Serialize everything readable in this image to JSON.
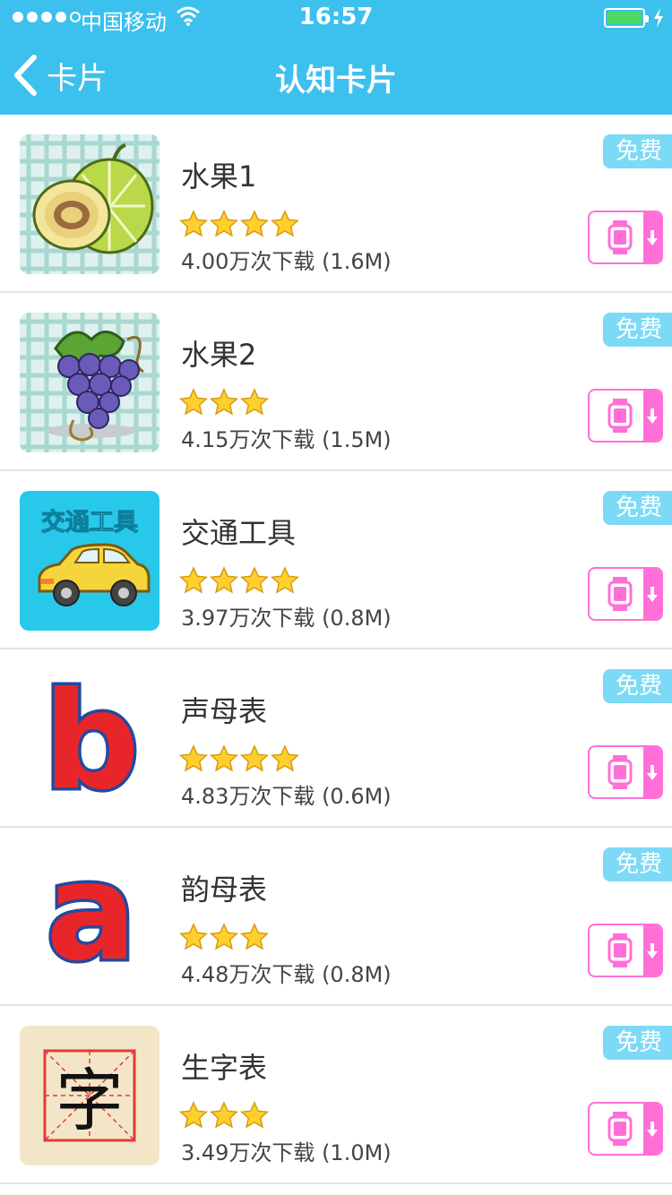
{
  "status_bar": {
    "carrier": "中国移动",
    "time": "16:57",
    "battery_color": "#4cd964"
  },
  "nav": {
    "back_label": "卡片",
    "title": "认知卡片"
  },
  "theme": {
    "header_color": "#3cc0ee",
    "badge_color": "#7ddaf6",
    "button_color": "#ff6fd7"
  },
  "items": [
    {
      "name": "水果1",
      "rating": 4,
      "downloads": "4.00万次下载 (1.6M)",
      "badge": "免费",
      "thumb_icon": "melon-icon"
    },
    {
      "name": "水果2",
      "rating": 3,
      "downloads": "4.15万次下载 (1.5M)",
      "badge": "免费",
      "thumb_icon": "grapes-icon"
    },
    {
      "name": "交通工具",
      "rating": 4,
      "downloads": "3.97万次下载 (0.8M)",
      "badge": "免费",
      "thumb_icon": "car-icon",
      "thumb_text": "交通工具"
    },
    {
      "name": "声母表",
      "rating": 4,
      "downloads": "4.83万次下载 (0.6M)",
      "badge": "免费",
      "thumb_icon": "letter-b-icon",
      "thumb_text": "b"
    },
    {
      "name": "韵母表",
      "rating": 3,
      "downloads": "4.48万次下载 (0.8M)",
      "badge": "免费",
      "thumb_icon": "letter-a-icon",
      "thumb_text": "a"
    },
    {
      "name": "生字表",
      "rating": 3,
      "downloads": "3.49万次下载 (1.0M)",
      "badge": "免费",
      "thumb_icon": "character-grid-icon",
      "thumb_text": "字"
    }
  ]
}
